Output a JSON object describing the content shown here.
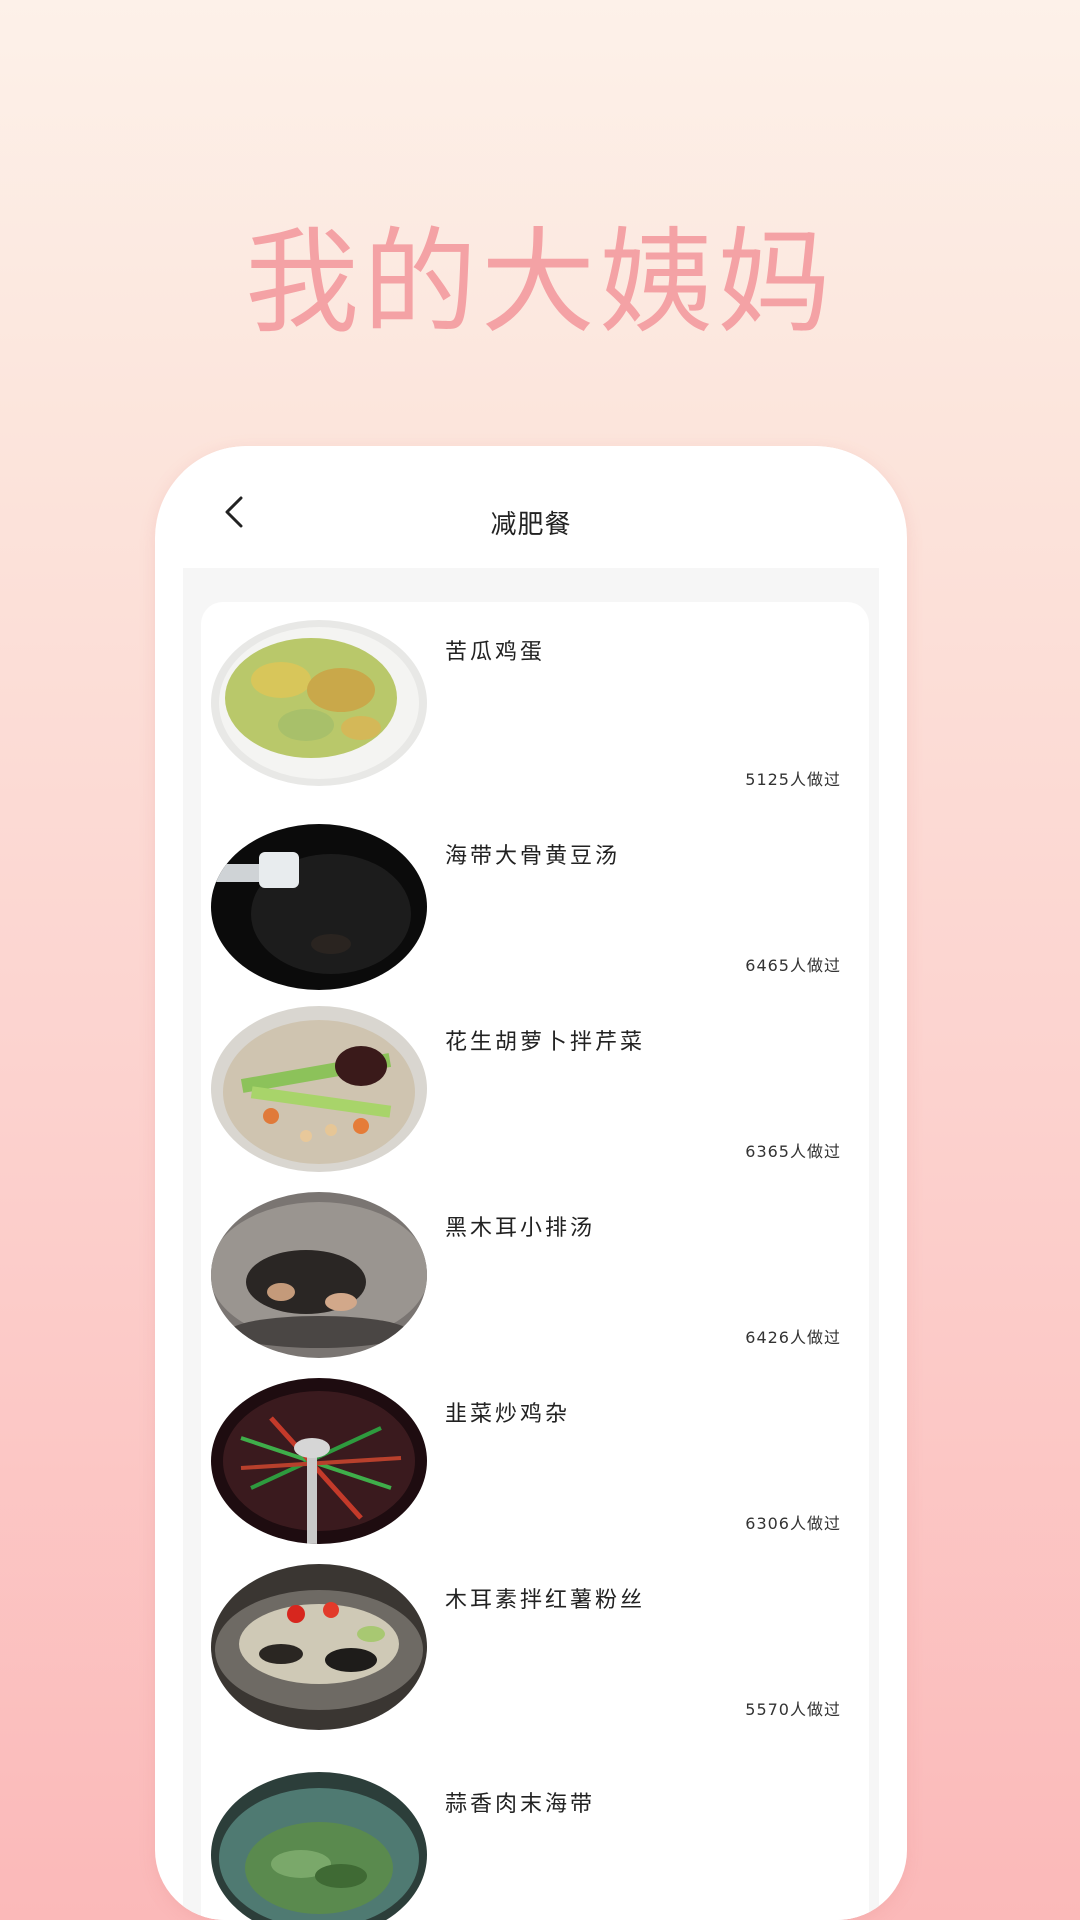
{
  "headline": "我的大姨妈",
  "nav": {
    "title": "减肥餐",
    "back_icon": "chevron-left-icon"
  },
  "recipes": [
    {
      "name": "苦瓜鸡蛋",
      "count": "5125人做过",
      "thumb_color": "#b9c86a"
    },
    {
      "name": "海带大骨黄豆汤",
      "count": "6465人做过",
      "thumb_color": "#111111"
    },
    {
      "name": "花生胡萝卜拌芹菜",
      "count": "6365人做过",
      "thumb_color": "#8cc25a"
    },
    {
      "name": "黑木耳小排汤",
      "count": "6426人做过",
      "thumb_color": "#6f6a66"
    },
    {
      "name": "韭菜炒鸡杂",
      "count": "6306人做过",
      "thumb_color": "#3a1a1e"
    },
    {
      "name": "木耳素拌红薯粉丝",
      "count": "5570人做过",
      "thumb_color": "#cfc9b6"
    },
    {
      "name": "蒜香肉末海带",
      "count": "",
      "thumb_color": "#3f6e63"
    }
  ]
}
